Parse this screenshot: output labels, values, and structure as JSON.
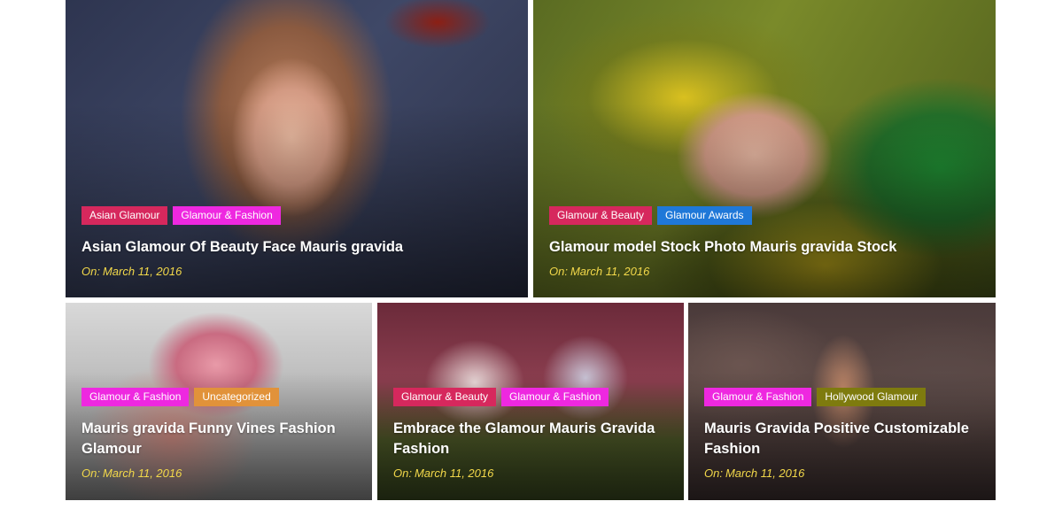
{
  "date_prefix": "On:",
  "tag_colors": {
    "asian_glamour": "#d6285d",
    "glamour_fashion": "#ee28e0",
    "glamour_beauty": "#d6285d",
    "glamour_awards": "#1f78d8",
    "uncategorized": "#e1923a",
    "hollywood_glamour": "#7e7b0e"
  },
  "posts": [
    {
      "title": "Asian Glamour Of Beauty Face Mauris gravida",
      "date": "March 11, 2016",
      "tags": [
        {
          "label": "Asian Glamour",
          "color": "#d6285d"
        },
        {
          "label": "Glamour & Fashion",
          "color": "#ee28e0"
        }
      ]
    },
    {
      "title": "Glamour model Stock Photo Mauris gravida Stock",
      "date": "March 11, 2016",
      "tags": [
        {
          "label": "Glamour & Beauty",
          "color": "#d6285d"
        },
        {
          "label": "Glamour Awards",
          "color": "#1f78d8"
        }
      ]
    },
    {
      "title": "Mauris gravida Funny Vines Fashion Glamour",
      "date": "March 11, 2016",
      "tags": [
        {
          "label": "Glamour & Fashion",
          "color": "#ee28e0"
        },
        {
          "label": "Uncategorized",
          "color": "#e1923a"
        }
      ]
    },
    {
      "title": "Embrace the Glamour Mauris Gravida Fashion",
      "date": "March 11, 2016",
      "tags": [
        {
          "label": "Glamour & Beauty",
          "color": "#d6285d"
        },
        {
          "label": "Glamour & Fashion",
          "color": "#ee28e0"
        }
      ]
    },
    {
      "title": "Mauris Gravida Positive Customizable Fashion",
      "date": "March 11, 2016",
      "tags": [
        {
          "label": "Glamour & Fashion",
          "color": "#ee28e0"
        },
        {
          "label": "Hollywood Glamour",
          "color": "#7e7b0e"
        }
      ]
    }
  ]
}
